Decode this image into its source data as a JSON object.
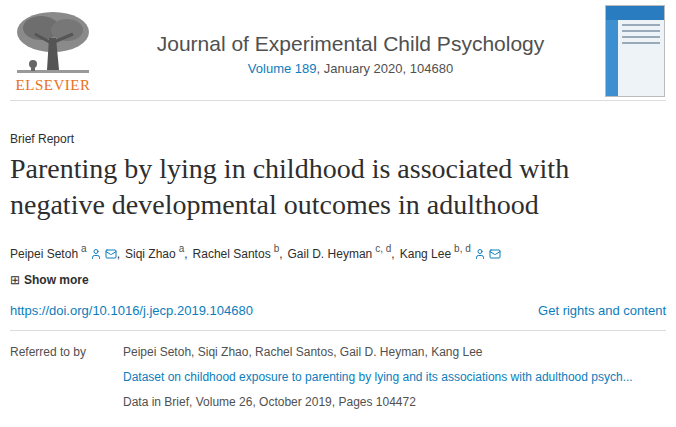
{
  "publisher": {
    "name": "ELSEVIER"
  },
  "journal": {
    "title": "Journal of Experimental Child Psychology",
    "volume": "Volume 189",
    "issue": ", January 2020, 104680"
  },
  "article": {
    "type": "Brief Report",
    "title": "Parenting by lying in childhood is associated with negative developmental outcomes in adulthood",
    "authors": [
      {
        "name": "Peipei Setoh",
        "affiliations": "a",
        "corresponding": true,
        "email": true,
        "separator": ","
      },
      {
        "name": "Siqi Zhao",
        "affiliations": "a",
        "corresponding": false,
        "email": false,
        "separator": ","
      },
      {
        "name": "Rachel Santos",
        "affiliations": "b",
        "corresponding": false,
        "email": false,
        "separator": ","
      },
      {
        "name": "Gail D. Heyman",
        "affiliations": "c, d",
        "corresponding": false,
        "email": false,
        "separator": ","
      },
      {
        "name": "Kang Lee",
        "affiliations": "b, d",
        "corresponding": true,
        "email": true,
        "separator": ""
      }
    ],
    "show_more": {
      "icon": "⊞",
      "label": "Show more"
    },
    "doi": "https://doi.org/10.1016/j.jecp.2019.104680",
    "rights": "Get rights and content"
  },
  "referred_to_by": {
    "label": "Referred to by",
    "items": [
      {
        "authors": "Peipei Setoh, Siqi Zhao, Rachel Santos, Gail D. Heyman, Kang Lee",
        "title": "Dataset on childhood exposure to parenting by lying and its associations with adulthood psych...",
        "source": "Data in Brief, Volume 26, October 2019, Pages 104472"
      }
    ]
  }
}
